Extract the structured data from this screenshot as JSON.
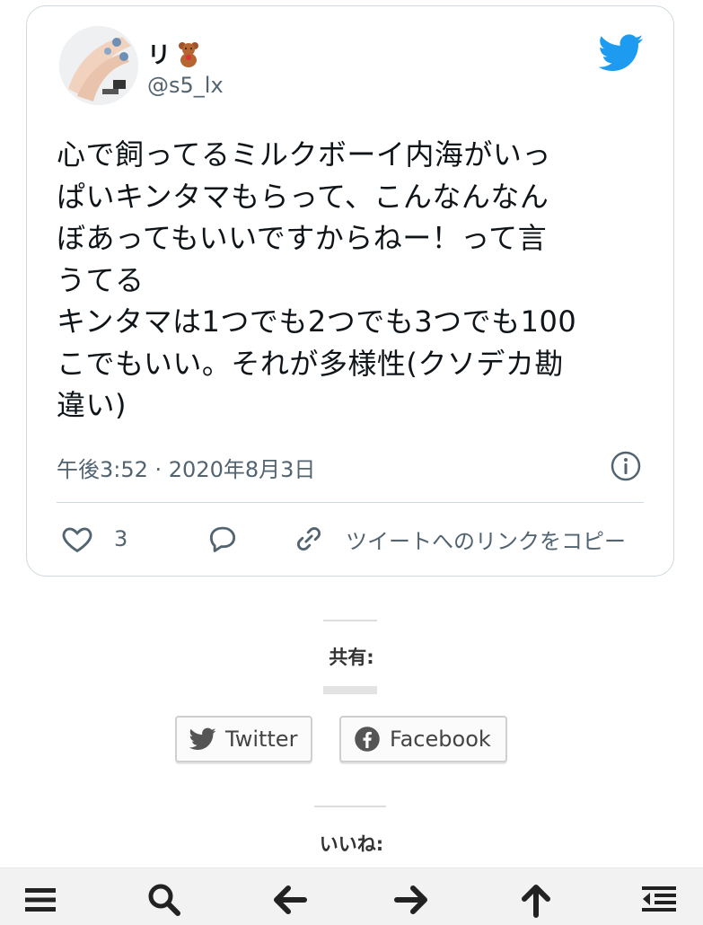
{
  "tweet": {
    "display_name": "リ",
    "name_emoji_icon": "teddy-bear-icon",
    "handle": "@s5_lx",
    "text_lines": [
      "心で飼ってるミルクボーイ内海がいっ",
      "ぱいキンタマもらって、こんなんなん",
      "ぼあってもいいですからねー！って言",
      "うてる",
      "キンタマは1つでも2つでも3つでも100",
      "こでもいい。それが多様性(クソデカ勘",
      "違い)"
    ],
    "timestamp": "午後3:52 · 2020年8月3日",
    "like_count": "3",
    "copy_link_label": "ツイートへのリンクをコピー",
    "colors": {
      "twitter_blue": "#1d9bf0",
      "text": "#0f1419",
      "muted": "#536471"
    }
  },
  "share": {
    "title": "共有:",
    "twitter_label": "Twitter",
    "facebook_label": "Facebook"
  },
  "likes": {
    "title": "いいね:"
  },
  "toolbar": {
    "icons": [
      "menu-icon",
      "search-icon",
      "arrow-left-icon",
      "arrow-right-icon",
      "arrow-up-icon",
      "outdent-list-icon"
    ]
  }
}
